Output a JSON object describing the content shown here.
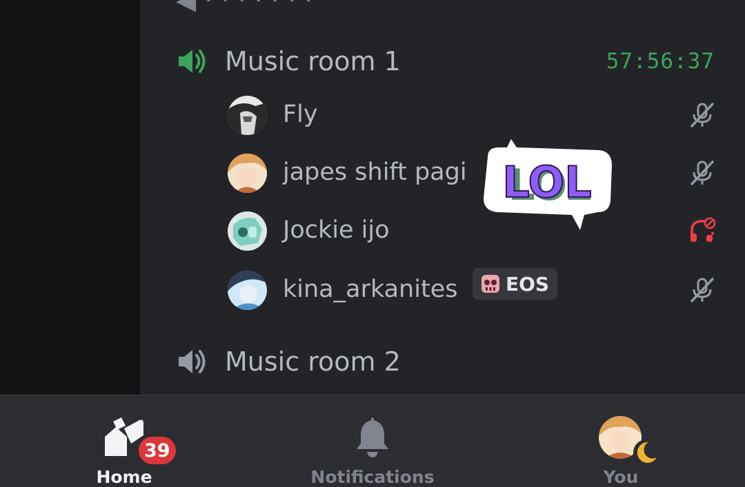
{
  "channels": [
    {
      "name": "Music room 1",
      "timer": "57:56:37",
      "active": true
    },
    {
      "name": "Music room 2",
      "active": false
    }
  ],
  "voice_users": [
    {
      "name": "Fly",
      "status": "muted"
    },
    {
      "name": "japes shift pagi",
      "status": "muted"
    },
    {
      "name": "Jockie ijo",
      "status": "deafened"
    },
    {
      "name": "kina_arkanites",
      "status": "muted",
      "tag": "EOS"
    }
  ],
  "sticker": {
    "text": "LOL"
  },
  "bottom_nav": {
    "home_label": "Home",
    "home_badge": "39",
    "notifications_label": "Notifications",
    "you_label": "You"
  },
  "colors": {
    "background": "#232428",
    "sidebar": "#111214",
    "nav": "#2b2d31",
    "timer": "#3ba55d",
    "speaker_active": "#3ba55d",
    "deafened": "#f23f43",
    "badge": "#da373c",
    "sticker_purple": "#8e5cf7",
    "sticker_green": "#6fe3a2"
  },
  "icons": [
    "speaker-active-icon",
    "speaker-icon",
    "muted-mic-icon",
    "deafened-headphones-icon",
    "skull-icon",
    "home-icon",
    "bell-icon",
    "moon-icon"
  ]
}
